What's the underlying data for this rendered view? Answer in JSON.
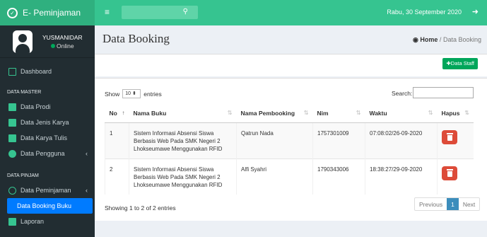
{
  "app": {
    "title": "E- Peminjaman",
    "date": "Rabu, 30 September 2020"
  },
  "user": {
    "name": "YUSMANIDAR",
    "status": "Online"
  },
  "sidebar": {
    "dashboard": "Dashboard",
    "header_master": "DATA MASTER",
    "master_items": [
      "Data Prodi",
      "Data Jenis Karya",
      "Data Karya Tulis",
      "Data Pengguna"
    ],
    "header_pinjam": "DATA PINJAM",
    "pinjam_items": [
      "Data Peminjaman",
      "Data Booking Buku",
      "Laporan"
    ]
  },
  "page": {
    "title": "Data Booking",
    "crumb_home": "Home",
    "crumb_sep": "/",
    "crumb_current": "Data Booking"
  },
  "toolbar": {
    "add_staff": "Data Staff"
  },
  "table_controls": {
    "show": "Show",
    "entries_value": "10",
    "entries": "entries",
    "search_label": "Search:"
  },
  "table": {
    "headers": [
      "No",
      "Nama Buku",
      "Nama Pembooking",
      "Nim",
      "Waktu",
      "Hapus"
    ],
    "rows": [
      {
        "no": "1",
        "buku": "Sistem Informasi Absensi Siswa Berbasis Web Pada SMK Negeri 2 Lhokseumawe Menggunakan RFID",
        "pembooking": "Qatrun Nada",
        "nim": "1757301009",
        "waktu": "07:08:02/26-09-2020"
      },
      {
        "no": "2",
        "buku": "Sistem Informasi Absensi Siswa Berbasis Web Pada SMK Negeri 2 Lhokseumawe Menggunakan RFID",
        "pembooking": "Alfi Syahri",
        "nim": "1790343006",
        "waktu": "18:38:27/29-09-2020"
      }
    ]
  },
  "footer": {
    "info": "Showing 1 to 2 of 2 entries",
    "previous": "Previous",
    "page": "1",
    "next": "Next"
  },
  "colors": {
    "topbar": "#36c490",
    "sidebar": "#222d32",
    "active": "#007bff",
    "delete": "#dd4b39",
    "add": "#00a65a"
  }
}
